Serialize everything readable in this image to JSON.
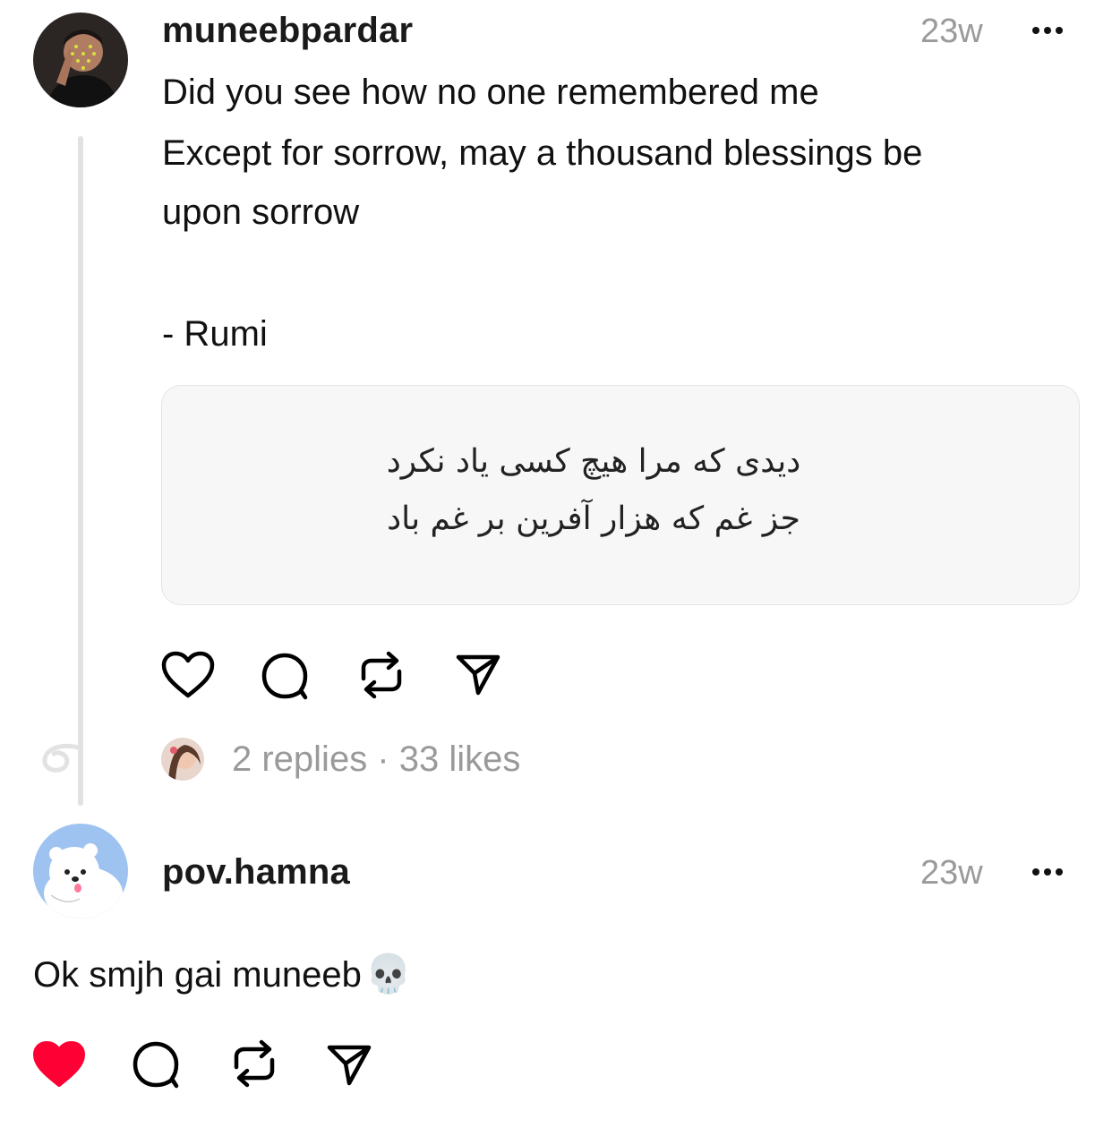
{
  "post": {
    "username": "muneebpardar",
    "time": "23w",
    "lines": [
      "Did you see how no one remembered me",
      "Except for sorrow, may a thousand blessings be\nupon sorrow",
      "- Rumi"
    ],
    "image_text": [
      "دیدی که مرا هیچ کسی یاد نکرد",
      "جز غم که هزار آفرین بر غم باد"
    ],
    "actions": [
      "heart-icon",
      "comment-icon",
      "repost-icon",
      "share-icon"
    ],
    "stats": "2 replies · 33 likes"
  },
  "reply": {
    "username": "pov.hamna",
    "time": "23w",
    "text": "Ok smjh gai muneeb",
    "emoji": "💀",
    "liked": true,
    "like_color": "#ff0034"
  },
  "colors": {
    "thread_line": "#e2e2e2",
    "muted": "#9a9a9a"
  }
}
